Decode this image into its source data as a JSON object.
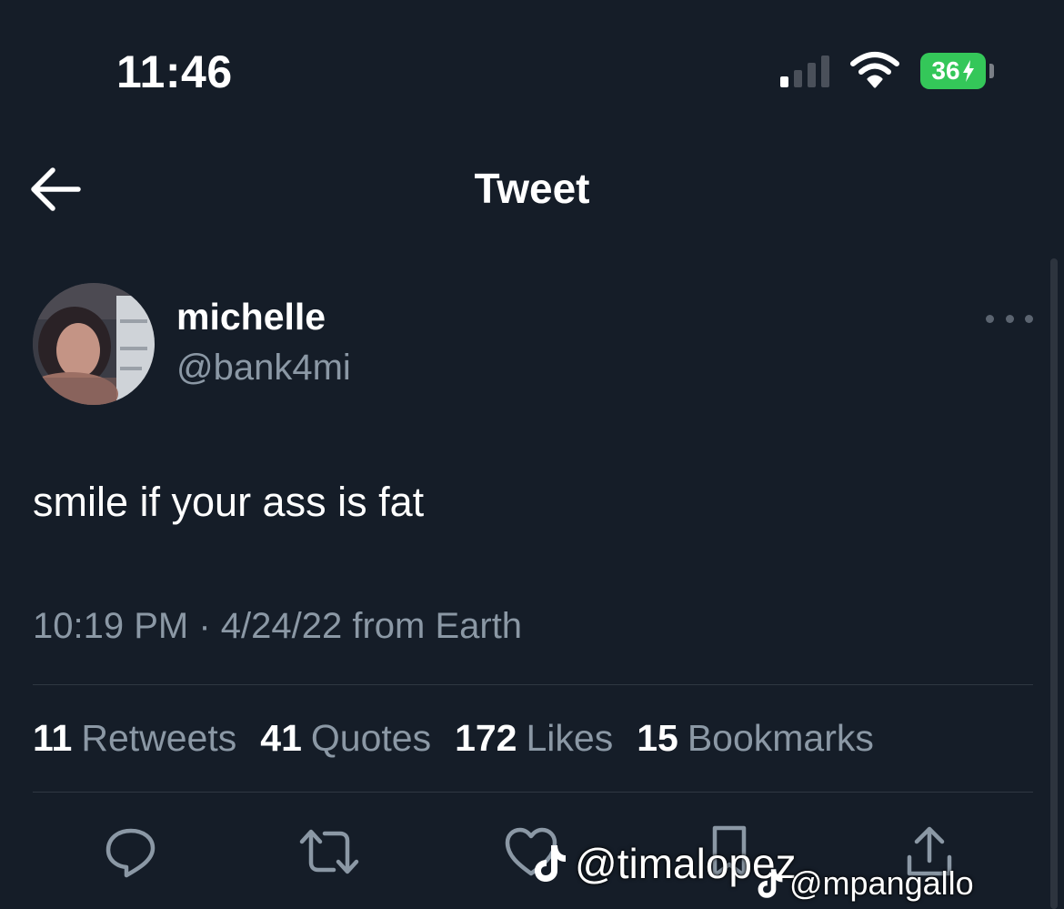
{
  "status_bar": {
    "time": "11:46",
    "battery": "36",
    "icons": [
      "cellular-signal-icon",
      "wifi-icon",
      "battery-charging-icon"
    ],
    "battery_color": "#34c759"
  },
  "header": {
    "title": "Tweet",
    "back_icon": "arrow-left-icon"
  },
  "tweet": {
    "display_name": "michelle",
    "handle": "@bank4mi",
    "text": "smile if your ass is fat",
    "timestamp": "10:19 PM · 4/24/22 from Earth",
    "more_icon": "more-horizontal-icon"
  },
  "stats": [
    {
      "count": "11",
      "label": "Retweets"
    },
    {
      "count": "41",
      "label": "Quotes"
    },
    {
      "count": "172",
      "label": "Likes"
    },
    {
      "count": "15",
      "label": "Bookmarks"
    }
  ],
  "actions": [
    "reply-icon",
    "retweet-icon",
    "like-icon",
    "bookmark-icon",
    "share-icon"
  ],
  "watermarks": [
    "@timalopez",
    "@mpangallo"
  ],
  "colors": {
    "background": "#151d28",
    "text_primary": "#ffffff",
    "text_secondary": "#8b98a5",
    "divider": "#2f3842",
    "icon": "#8b98a5"
  }
}
